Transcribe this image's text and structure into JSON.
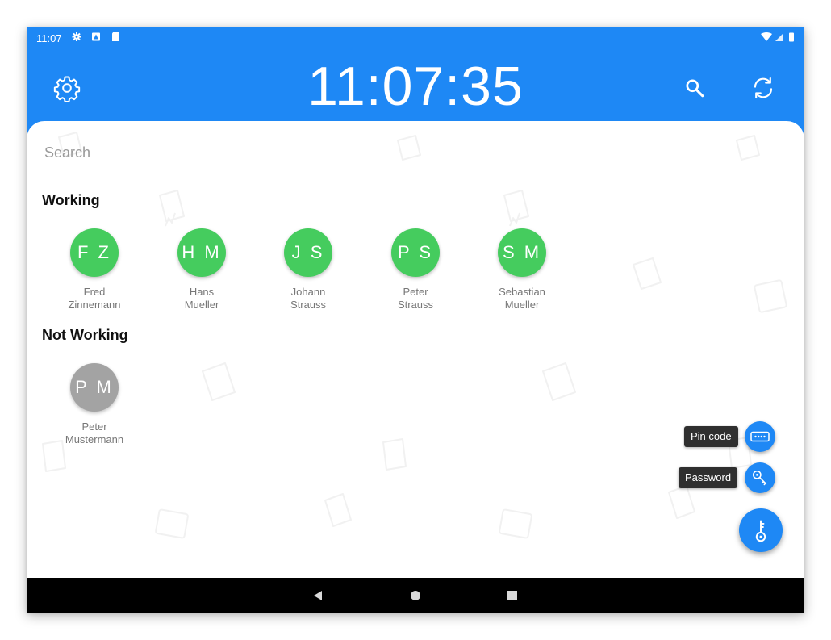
{
  "status_bar": {
    "time": "11:07",
    "left_icons": [
      "settings-small-icon",
      "notification-icon",
      "sd-card-icon"
    ],
    "right_icons": [
      "wifi-icon",
      "signal-icon",
      "battery-icon"
    ]
  },
  "header": {
    "clock": "11:07:35",
    "left_icon": "gear-icon",
    "right_icons": [
      "search-icon",
      "sync-icon"
    ],
    "background_color": "#1e88f5"
  },
  "search": {
    "placeholder": "Search",
    "value": ""
  },
  "sections": {
    "working": {
      "title": "Working",
      "status_color": "#45cc5e",
      "people": [
        {
          "initials": "F Z",
          "first": "Fred",
          "last": "Zinnemann"
        },
        {
          "initials": "H M",
          "first": "Hans",
          "last": "Mueller"
        },
        {
          "initials": "J S",
          "first": "Johann",
          "last": "Strauss"
        },
        {
          "initials": "P S",
          "first": "Peter",
          "last": "Strauss"
        },
        {
          "initials": "S M",
          "first": "Sebastian",
          "last": "Mueller"
        }
      ]
    },
    "not_working": {
      "title": "Not Working",
      "status_color": "#a3a3a3",
      "people": [
        {
          "initials": "P M",
          "first": "Peter",
          "last": "Mustermann"
        }
      ]
    }
  },
  "fab_menu": {
    "pin_label": "Pin code",
    "pin_icon": "pin-code-icon",
    "password_label": "Password",
    "password_icon": "key-icon",
    "main_icon": "key-icon",
    "accent_color": "#1e88f5"
  },
  "nav_bar": {
    "buttons": [
      "back-icon",
      "home-icon",
      "recents-icon"
    ]
  }
}
